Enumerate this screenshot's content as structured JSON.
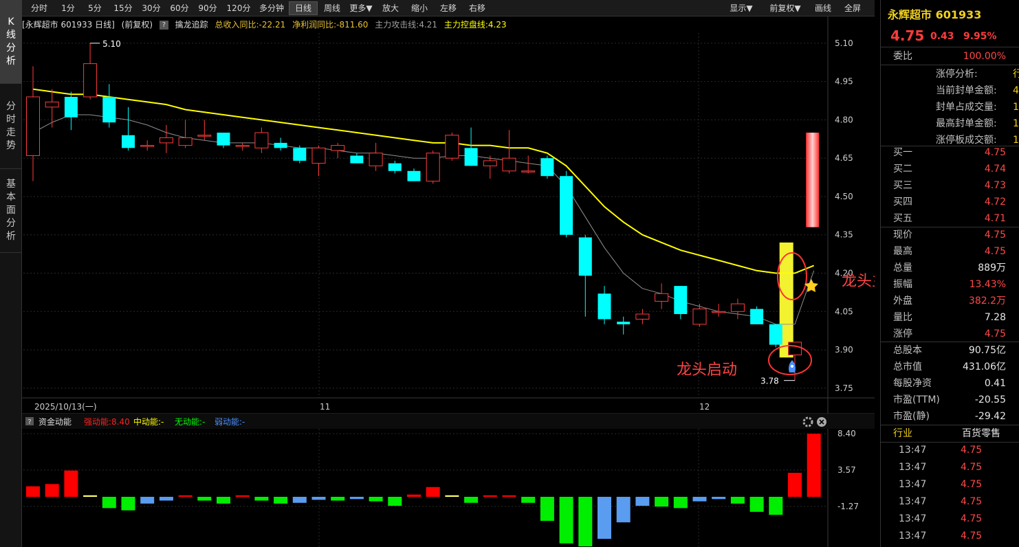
{
  "nav": [
    {
      "label": "K线分析",
      "active": true
    },
    {
      "label": "分时走势",
      "active": false
    },
    {
      "label": "基本面分析",
      "active": false
    }
  ],
  "toolbar": {
    "buttons": [
      "分时",
      "1分",
      "5分",
      "15分",
      "30分",
      "60分",
      "90分",
      "120分",
      "多分钟",
      "日线",
      "周线",
      "更多▼",
      "放大",
      "缩小",
      "左移",
      "右移"
    ],
    "active": "日线",
    "right_buttons": [
      "显示▼",
      "前复权▼",
      "画线",
      "全屏"
    ]
  },
  "infobar": {
    "title": "[永辉超市 601933 日线]",
    "adjust": "(前复权)",
    "help": "?",
    "indicator_name": "擒龙追踪",
    "revenue": "总收入同比:-22.21",
    "profit": "净利润同比:-811.60",
    "attack_line": "主力攻击线:4.21",
    "control_line": "主力控盘线:4.23"
  },
  "price_axis": [
    "5.10",
    "4.95",
    "4.80",
    "4.65",
    "4.50",
    "4.35",
    "4.20",
    "4.05",
    "3.90",
    "3.75"
  ],
  "date_axis": [
    "2025/10/13(一)",
    "11",
    "12"
  ],
  "high_label": "5.10",
  "low_label": "3.78",
  "annotation_top": "龙头主升",
  "annotation_bottom": "龙头启动",
  "colors": {
    "up": "#ff3c3c",
    "down": "#00ffff",
    "ma_yellow": "#ffff00",
    "ma_gray": "#909090",
    "highlight_yellow": "#ffff33"
  },
  "chart_data": [
    {
      "type": "candlestick",
      "title": "永辉超市 601933 日线",
      "ylim": [
        3.72,
        5.14
      ],
      "candles": [
        [
          4.66,
          4.89,
          5.01,
          4.56
        ],
        [
          4.85,
          4.87,
          4.92,
          4.77
        ],
        [
          4.89,
          4.81,
          4.91,
          4.76
        ],
        [
          4.89,
          5.02,
          5.1,
          4.88
        ],
        [
          4.89,
          4.79,
          4.94,
          4.77
        ],
        [
          4.74,
          4.69,
          4.85,
          4.68
        ],
        [
          4.7,
          4.7,
          4.72,
          4.68
        ],
        [
          4.71,
          4.73,
          4.78,
          4.67
        ],
        [
          4.7,
          4.73,
          4.8,
          4.69
        ],
        [
          4.74,
          4.74,
          4.8,
          4.72
        ],
        [
          4.75,
          4.7,
          4.75,
          4.69
        ],
        [
          4.7,
          4.7,
          4.71,
          4.68
        ],
        [
          4.69,
          4.75,
          4.77,
          4.67
        ],
        [
          4.71,
          4.69,
          4.73,
          4.68
        ],
        [
          4.69,
          4.64,
          4.7,
          4.63
        ],
        [
          4.63,
          4.69,
          4.7,
          4.58
        ],
        [
          4.68,
          4.7,
          4.71,
          4.65
        ],
        [
          4.66,
          4.63,
          4.67,
          4.63
        ],
        [
          4.62,
          4.67,
          4.71,
          4.6
        ],
        [
          4.63,
          4.6,
          4.64,
          4.59
        ],
        [
          4.6,
          4.56,
          4.61,
          4.56
        ],
        [
          4.56,
          4.67,
          4.68,
          4.55
        ],
        [
          4.65,
          4.74,
          4.75,
          4.64
        ],
        [
          4.69,
          4.62,
          4.77,
          4.62
        ],
        [
          4.62,
          4.64,
          4.66,
          4.57
        ],
        [
          4.6,
          4.65,
          4.76,
          4.59
        ],
        [
          4.6,
          4.6,
          4.66,
          4.59
        ],
        [
          4.65,
          4.58,
          4.66,
          4.57
        ],
        [
          4.58,
          4.35,
          4.6,
          4.34
        ],
        [
          4.34,
          4.19,
          4.35,
          4.03
        ],
        [
          4.12,
          4.02,
          4.15,
          4.0
        ],
        [
          4.01,
          4.0,
          4.03,
          3.96
        ],
        [
          4.02,
          4.04,
          4.06,
          4.0
        ],
        [
          4.09,
          4.12,
          4.16,
          4.06
        ],
        [
          4.15,
          4.04,
          4.15,
          4.02
        ],
        [
          4.0,
          4.06,
          4.08,
          3.99
        ],
        [
          4.05,
          4.05,
          4.08,
          4.03
        ],
        [
          4.05,
          4.08,
          4.1,
          4.02
        ],
        [
          4.06,
          4.0,
          4.07,
          4.0
        ],
        [
          4.0,
          3.92,
          4.0,
          3.91
        ],
        [
          3.88,
          3.93,
          3.93,
          3.78
        ],
        [
          4.38,
          4.75,
          4.75,
          4.38
        ]
      ],
      "ma_yellow": [
        4.92,
        4.91,
        4.9,
        4.9,
        4.89,
        4.88,
        4.87,
        4.86,
        4.84,
        4.83,
        4.82,
        4.81,
        4.8,
        4.79,
        4.78,
        4.77,
        4.76,
        4.75,
        4.74,
        4.73,
        4.72,
        4.71,
        4.71,
        4.7,
        4.7,
        4.69,
        4.69,
        4.67,
        4.62,
        4.54,
        4.46,
        4.4,
        4.35,
        4.32,
        4.29,
        4.27,
        4.25,
        4.23,
        4.21,
        4.2,
        4.2,
        4.23
      ],
      "ma_gray": [
        4.75,
        4.79,
        4.82,
        4.82,
        4.81,
        4.8,
        4.78,
        4.75,
        4.73,
        4.72,
        4.71,
        4.71,
        4.71,
        4.7,
        4.69,
        4.69,
        4.68,
        4.67,
        4.67,
        4.66,
        4.65,
        4.65,
        4.66,
        4.66,
        4.65,
        4.64,
        4.63,
        4.62,
        4.54,
        4.42,
        4.3,
        4.2,
        4.14,
        4.12,
        4.09,
        4.07,
        4.05,
        4.04,
        4.03,
        4.0,
        4.0,
        4.21
      ]
    },
    {
      "type": "bar",
      "title": "资金动能",
      "legend": [
        "强动能:8.40",
        "中动能:-",
        "无动能:-",
        "弱动能:-"
      ],
      "ticks": [
        "8.40",
        "3.57",
        "-1.27"
      ],
      "ylim": [
        -6.5,
        8.6
      ],
      "values": [
        1.4,
        1.7,
        3.5,
        0.2,
        -1.5,
        -1.8,
        -0.9,
        -0.5,
        0.2,
        -0.5,
        -0.9,
        0.2,
        -0.5,
        -0.9,
        -0.8,
        -0.4,
        -0.5,
        -0.3,
        -0.6,
        -1.2,
        0.3,
        1.3,
        0.2,
        -0.8,
        0.2,
        0.2,
        -0.8,
        -3.2,
        -6.2,
        -6.6,
        -5.6,
        -3.4,
        -1.2,
        -1.3,
        -1.5,
        -0.6,
        -0.3,
        -0.9,
        -2.0,
        -2.4,
        3.2,
        8.4
      ],
      "colors": [
        "r",
        "r",
        "r",
        "y",
        "g",
        "g",
        "b",
        "b",
        "r",
        "g",
        "g",
        "r",
        "g",
        "g",
        "b",
        "b",
        "g",
        "b",
        "g",
        "g",
        "r",
        "r",
        "y",
        "g",
        "r",
        "r",
        "g",
        "g",
        "g",
        "g",
        "b",
        "b",
        "b",
        "g",
        "g",
        "b",
        "b",
        "g",
        "g",
        "g",
        "r",
        "r"
      ]
    }
  ],
  "quote": {
    "name": "永辉超市 601933",
    "price": "4.75",
    "change": "0.43",
    "pct": "9.95%",
    "weibi_label": "委比",
    "weibi": "100.00%",
    "limit_rows": [
      {
        "label": "涨停分析:",
        "value": "行业原"
      },
      {
        "label": "当前封单金额:",
        "value": "4"
      },
      {
        "label": "封单占成交量:",
        "value": "1"
      },
      {
        "label": "最高封单金额:",
        "value": "1"
      },
      {
        "label": "涨停板成交额:",
        "value": "1"
      }
    ],
    "bids": [
      {
        "label": "买一",
        "value": "4.75"
      },
      {
        "label": "买二",
        "value": "4.74"
      },
      {
        "label": "买三",
        "value": "4.73"
      },
      {
        "label": "买四",
        "value": "4.72"
      },
      {
        "label": "买五",
        "value": "4.71"
      }
    ],
    "stats": [
      {
        "label": "现价",
        "value": "4.75",
        "color": "red"
      },
      {
        "label": "最高",
        "value": "4.75",
        "color": "red"
      },
      {
        "label": "总量",
        "value": "889万",
        "color": "white"
      },
      {
        "label": "振幅",
        "value": "13.43%",
        "color": "red"
      },
      {
        "label": "外盘",
        "value": "382.2万",
        "color": "red"
      },
      {
        "label": "量比",
        "value": "7.28",
        "color": "white"
      },
      {
        "label": "涨停",
        "value": "4.75",
        "color": "red"
      }
    ],
    "fundamentals": [
      {
        "label": "总股本",
        "value": "90.75亿"
      },
      {
        "label": "总市值",
        "value": "431.06亿"
      },
      {
        "label": "每股净资",
        "value": "0.41"
      },
      {
        "label": "市盈(TTM)",
        "value": "-20.55"
      },
      {
        "label": "市盈(静)",
        "value": "-29.42"
      }
    ],
    "industry_label": "行业",
    "industry": "百货零售",
    "ticks": [
      {
        "time": "13:47",
        "price": "4.75"
      },
      {
        "time": "13:47",
        "price": "4.75"
      },
      {
        "time": "13:47",
        "price": "4.75"
      },
      {
        "time": "13:47",
        "price": "4.75"
      },
      {
        "time": "13:47",
        "price": "4.75"
      },
      {
        "time": "13:47",
        "price": "4.75"
      }
    ]
  }
}
